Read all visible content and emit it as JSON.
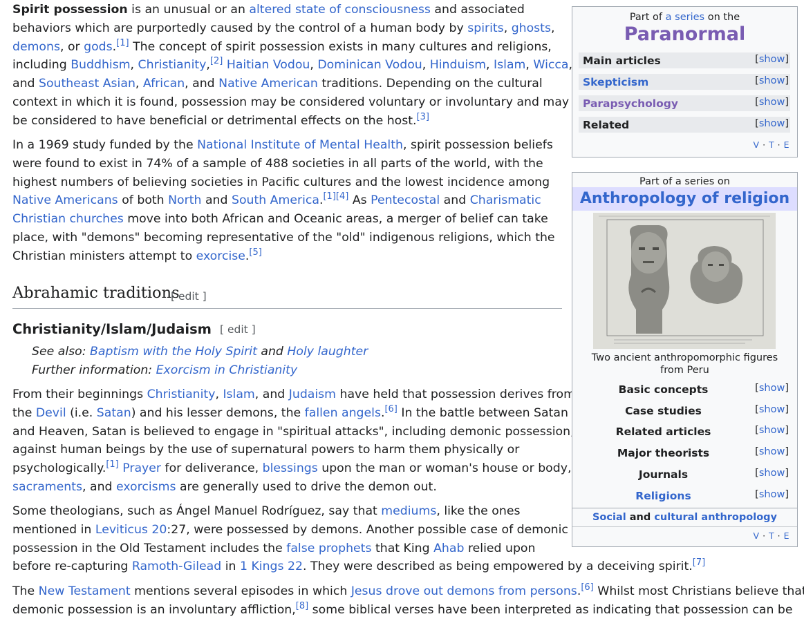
{
  "p1": {
    "l1": {
      "a": "Spirit possession",
      "b": " is an unusual or an ",
      "c": "altered state of consciousness",
      "d": " and associated"
    },
    "l2": {
      "a": "behaviors which are purportedly caused by the control of a human body by ",
      "b": "spirits",
      "c": ", ",
      "d": "ghosts",
      "e": ","
    },
    "l3": {
      "a": "demons",
      "b": ", or ",
      "c": "gods",
      "d": ".",
      "e": "[1]",
      "f": " The concept of spirit possession exists in many cultures and religions,"
    },
    "l4": {
      "a": "including ",
      "b": "Buddhism",
      "c": ", ",
      "d": "Christianity",
      "e": ",",
      "f": "[2]",
      "g": " ",
      "h": "Haitian Vodou",
      "i": ", ",
      "j": "Dominican Vodou",
      "k": ", ",
      "l": "Hinduism",
      "m": ", ",
      "n": "Islam",
      "o": ", ",
      "p": "Wicca",
      "q": ","
    },
    "l5": {
      "a": "and ",
      "b": "Southeast Asian",
      "c": ", ",
      "d": "African",
      "e": ", and ",
      "f": "Native American",
      "g": " traditions. Depending on the cultural"
    },
    "l6": {
      "a": "context in which it is found, possession may be considered voluntary or involuntary and may"
    },
    "l7": {
      "a": "be considered to have beneficial or detrimental effects on the host.",
      "b": "[3]"
    }
  },
  "p2": {
    "l1": {
      "a": "In a 1969 study funded by the ",
      "b": "National Institute of Mental Health",
      "c": ", spirit possession beliefs"
    },
    "l2": {
      "a": "were found to exist in 74% of a sample of 488 societies in all parts of the world, with the"
    },
    "l3": {
      "a": "highest numbers of believing societies in Pacific cultures and the lowest incidence among"
    },
    "l4": {
      "a": "Native Americans",
      "b": " of both ",
      "c": "North",
      "d": " and ",
      "e": "South America",
      "f": ".",
      "g": "[1][4]",
      "h": " As ",
      "i": "Pentecostal",
      "j": " and ",
      "k": "Charismatic"
    },
    "l5": {
      "a": "Christian churches",
      "b": " move into both African and Oceanic areas, a merger of belief can take"
    },
    "l6": {
      "a": "place, with \"demons\" becoming representative of the \"old\" indigenous religions, which the"
    },
    "l7": {
      "a": "Christian ministers attempt to ",
      "b": "exorcise",
      "c": ".",
      "d": "[5]"
    }
  },
  "h2": {
    "title": "Abrahamic traditions",
    "edit": "[ edit ]"
  },
  "h3": {
    "title": "Christianity/Islam/Judaism",
    "edit": "[ edit ]"
  },
  "hat1": {
    "a": "See also: ",
    "b": "Baptism with the Holy Spirit",
    "c": " and ",
    "d": "Holy laughter"
  },
  "hat2": {
    "a": "Further information: ",
    "b": "Exorcism in Christianity"
  },
  "p3": {
    "l1": {
      "a": "From their beginnings ",
      "b": "Christianity",
      "c": ", ",
      "d": "Islam",
      "e": ", and ",
      "f": "Judaism",
      "g": " have held that possession derives from"
    },
    "l2": {
      "a": "the ",
      "b": "Devil",
      "c": " (i.e. ",
      "d": "Satan",
      "e": ") and his lesser demons, the ",
      "f": "fallen angels",
      "g": ".",
      "h": "[6]",
      "i": " In the battle between Satan"
    },
    "l3": {
      "a": "and Heaven, Satan is believed to engage in \"spiritual attacks\", including demonic possession,"
    },
    "l4": {
      "a": "against human beings by the use of supernatural powers to harm them physically or"
    },
    "l5": {
      "a": "psychologically.",
      "b": "[1]",
      "c": " ",
      "d": "Prayer",
      "e": " for deliverance, ",
      "f": "blessings",
      "g": " upon the man or woman's house or body,"
    },
    "l6": {
      "a": "sacraments",
      "b": ", and ",
      "c": "exorcisms",
      "d": " are generally used to drive the demon out."
    }
  },
  "p4": {
    "l1": {
      "a": "Some theologians, such as Ángel Manuel Rodríguez, say that ",
      "b": "mediums",
      "c": ", like the ones"
    },
    "l2": {
      "a": "mentioned in ",
      "b": "Leviticus 20",
      "c": ":27, were possessed by demons. Another possible case of demonic"
    },
    "l3": {
      "a": "possession in the Old Testament includes the ",
      "b": "false prophets",
      "c": " that King ",
      "d": "Ahab",
      "e": " relied upon"
    },
    "l4": {
      "a": "before re-capturing ",
      "b": "Ramoth-Gilead",
      "c": " in ",
      "d": "1 Kings 22",
      "e": ". They were described as being empowered by a deceiving spirit.",
      "f": "[7]"
    }
  },
  "p5": {
    "l1": {
      "a": "The ",
      "b": "New Testament",
      "c": " mentions several episodes in which ",
      "d": "Jesus drove out demons from persons",
      "e": ".",
      "f": "[6]",
      "g": " Whilst most Christians believe that"
    },
    "l2": {
      "a": "demonic possession is an involuntary affliction,",
      "b": "[8]",
      "c": " some biblical verses have been interpreted as indicating that possession can be"
    }
  },
  "sidebar1": {
    "pre_a": "Part of ",
    "pre_b": "a series",
    "pre_c": " on the",
    "title": "Paranormal",
    "rows": [
      {
        "label": "Main articles",
        "show": "show"
      },
      {
        "label": "Skepticism",
        "show": "show"
      },
      {
        "label": "Parapsychology",
        "show": "show"
      },
      {
        "label": "Related",
        "show": "show"
      }
    ],
    "vte": {
      "v": "V",
      "t": "T",
      "e": "E"
    }
  },
  "sidebar2": {
    "pre": "Part of a series on",
    "title": "Anthropology of religion",
    "caption_l1": "Two ancient anthropomorphic figures",
    "caption_l2": "from Peru",
    "rows": [
      {
        "label": "Basic concepts",
        "show": "show"
      },
      {
        "label": "Case studies",
        "show": "show"
      },
      {
        "label": "Related articles",
        "show": "show"
      },
      {
        "label": "Major theorists",
        "show": "show"
      },
      {
        "label": "Journals",
        "show": "show"
      },
      {
        "label": "Religions",
        "show": "show"
      }
    ],
    "footer": {
      "a": "Social",
      "b": " and ",
      "c": "cultural anthropology"
    },
    "vte": {
      "v": "V",
      "t": "T",
      "e": "E"
    }
  },
  "colors": {
    "link": "#3366cc",
    "visited_link": "#795cb2",
    "text": "#202122",
    "sidebar_bg": "#f8f9fa",
    "title_band": "#ddddff"
  }
}
